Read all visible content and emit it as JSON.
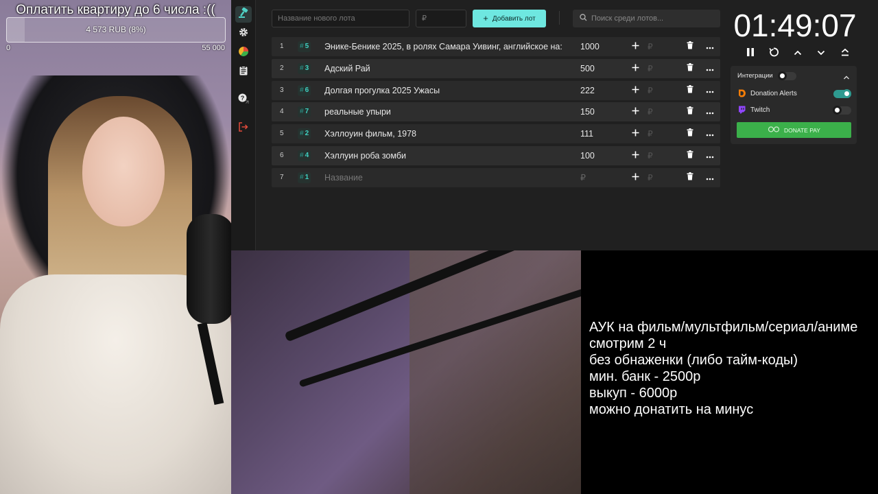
{
  "goal": {
    "title": "Оплатить квартиру до 6 числа :((",
    "progress_text": "4 573 RUB (8%)",
    "progress_fraction": 0.083,
    "min": "0",
    "max": "55 000"
  },
  "toolbar": {
    "new_lot_placeholder": "Название нового лота",
    "amount_placeholder": "₽",
    "add_lot_label": "Добавить лот",
    "search_placeholder": "Поиск среди лотов..."
  },
  "sidebar": {
    "items": [
      {
        "name": "auction-icon"
      },
      {
        "name": "settings-icon"
      },
      {
        "name": "stats-pie-icon"
      },
      {
        "name": "clipboard-icon"
      },
      {
        "name": "help-icon"
      },
      {
        "name": "logout-icon"
      }
    ]
  },
  "lots": [
    {
      "index": "1",
      "id": "5",
      "name": "Энике-Бенике 2025,  в ролях Самара Уивинг, английское на:",
      "amount": "1000"
    },
    {
      "index": "2",
      "id": "3",
      "name": "Адский Рай",
      "amount": "500"
    },
    {
      "index": "3",
      "id": "6",
      "name": "Долгая прогулка 2025 Ужасы",
      "amount": "222"
    },
    {
      "index": "4",
      "id": "7",
      "name": "реальные упыри",
      "amount": "150"
    },
    {
      "index": "5",
      "id": "2",
      "name": "Хэллоуин фильм, 1978",
      "amount": "111"
    },
    {
      "index": "6",
      "id": "4",
      "name": "Хэллуин роба зомби",
      "amount": "100"
    },
    {
      "index": "7",
      "id": "1",
      "name": "",
      "amount": "",
      "name_placeholder": "Название",
      "amount_placeholder": "₽"
    }
  ],
  "lot_rub_sign": "₽",
  "timer": {
    "value": "01:49:07"
  },
  "integrations": {
    "title": "Интеграции",
    "master_enabled": false,
    "items": [
      {
        "name": "Donation Alerts",
        "enabled": true,
        "icon": "donationalerts-icon",
        "color": "#f57d07"
      },
      {
        "name": "Twitch",
        "enabled": false,
        "icon": "twitch-icon",
        "color": "#9146ff"
      }
    ],
    "donatepay_label": "DONATE PAY"
  },
  "rules": {
    "lines": [
      "АУК на фильм/мультфильм/сериал/аниме",
      "смотрим 2 ч",
      "без обнаженки (либо тайм-коды)",
      "мин. банк - 2500р",
      "выкуп - 6000р",
      "можно донатить на минус"
    ]
  },
  "colors": {
    "accent": "#6ee7e0",
    "app_bg": "#202020",
    "row_bg": "#2a2a2a",
    "donatepay_green": "#3bb04a",
    "lot_id": "#3fd1c2"
  }
}
